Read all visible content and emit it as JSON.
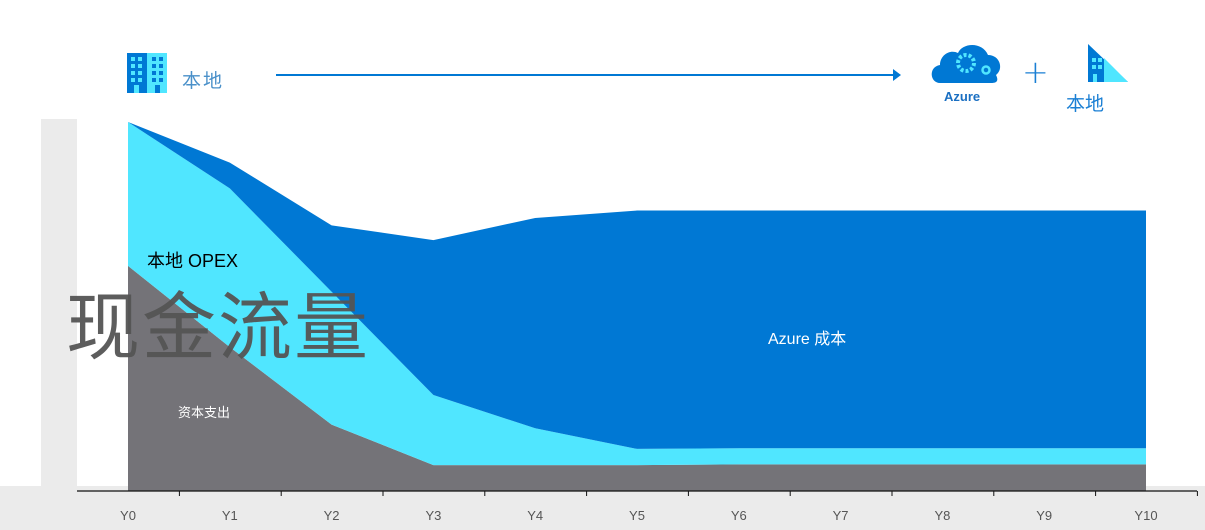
{
  "header": {
    "left_label": "本地",
    "right_azure_label": "Azure",
    "plus": "+",
    "right_onprem_label": "本地",
    "icons": [
      "building-icon",
      "arrow-right-icon",
      "azure-cloud-gear-icon",
      "building-hybrid-icon"
    ]
  },
  "colors": {
    "capex": "#747378",
    "opex": "#50e6ff",
    "azure": "#0078d4",
    "accent": "#0078d4",
    "band": "#ebebeb",
    "axis_text": "#555555"
  },
  "chart_data": {
    "type": "area",
    "stacked": true,
    "title": "现金流量",
    "xlabel": "",
    "ylabel": "",
    "categories": [
      "Y0",
      "Y1",
      "Y2",
      "Y3",
      "Y4",
      "Y5",
      "Y6",
      "Y7",
      "Y8",
      "Y9",
      "Y10"
    ],
    "ylim": [
      0,
      100
    ],
    "grid": false,
    "series": [
      {
        "name": "资本支出",
        "color": "#747378",
        "values": [
          61,
          39,
          18,
          7,
          7,
          7,
          7.2,
          7.2,
          7.2,
          7.2,
          7.2
        ]
      },
      {
        "name": "本地 OPEX",
        "color": "#50e6ff",
        "values": [
          39,
          43,
          36,
          19,
          10,
          4.4,
          4.4,
          4.4,
          4.4,
          4.4,
          4.4
        ]
      },
      {
        "name": "Azure 成本",
        "color": "#0078d4",
        "values": [
          0,
          7,
          18,
          42,
          57,
          64.6,
          64.4,
          64.4,
          64.4,
          64.4,
          64.4
        ]
      }
    ],
    "annotations": {
      "opex": "本地 OPEX",
      "capex": "资本支出",
      "azure": "Azure 成本"
    }
  }
}
